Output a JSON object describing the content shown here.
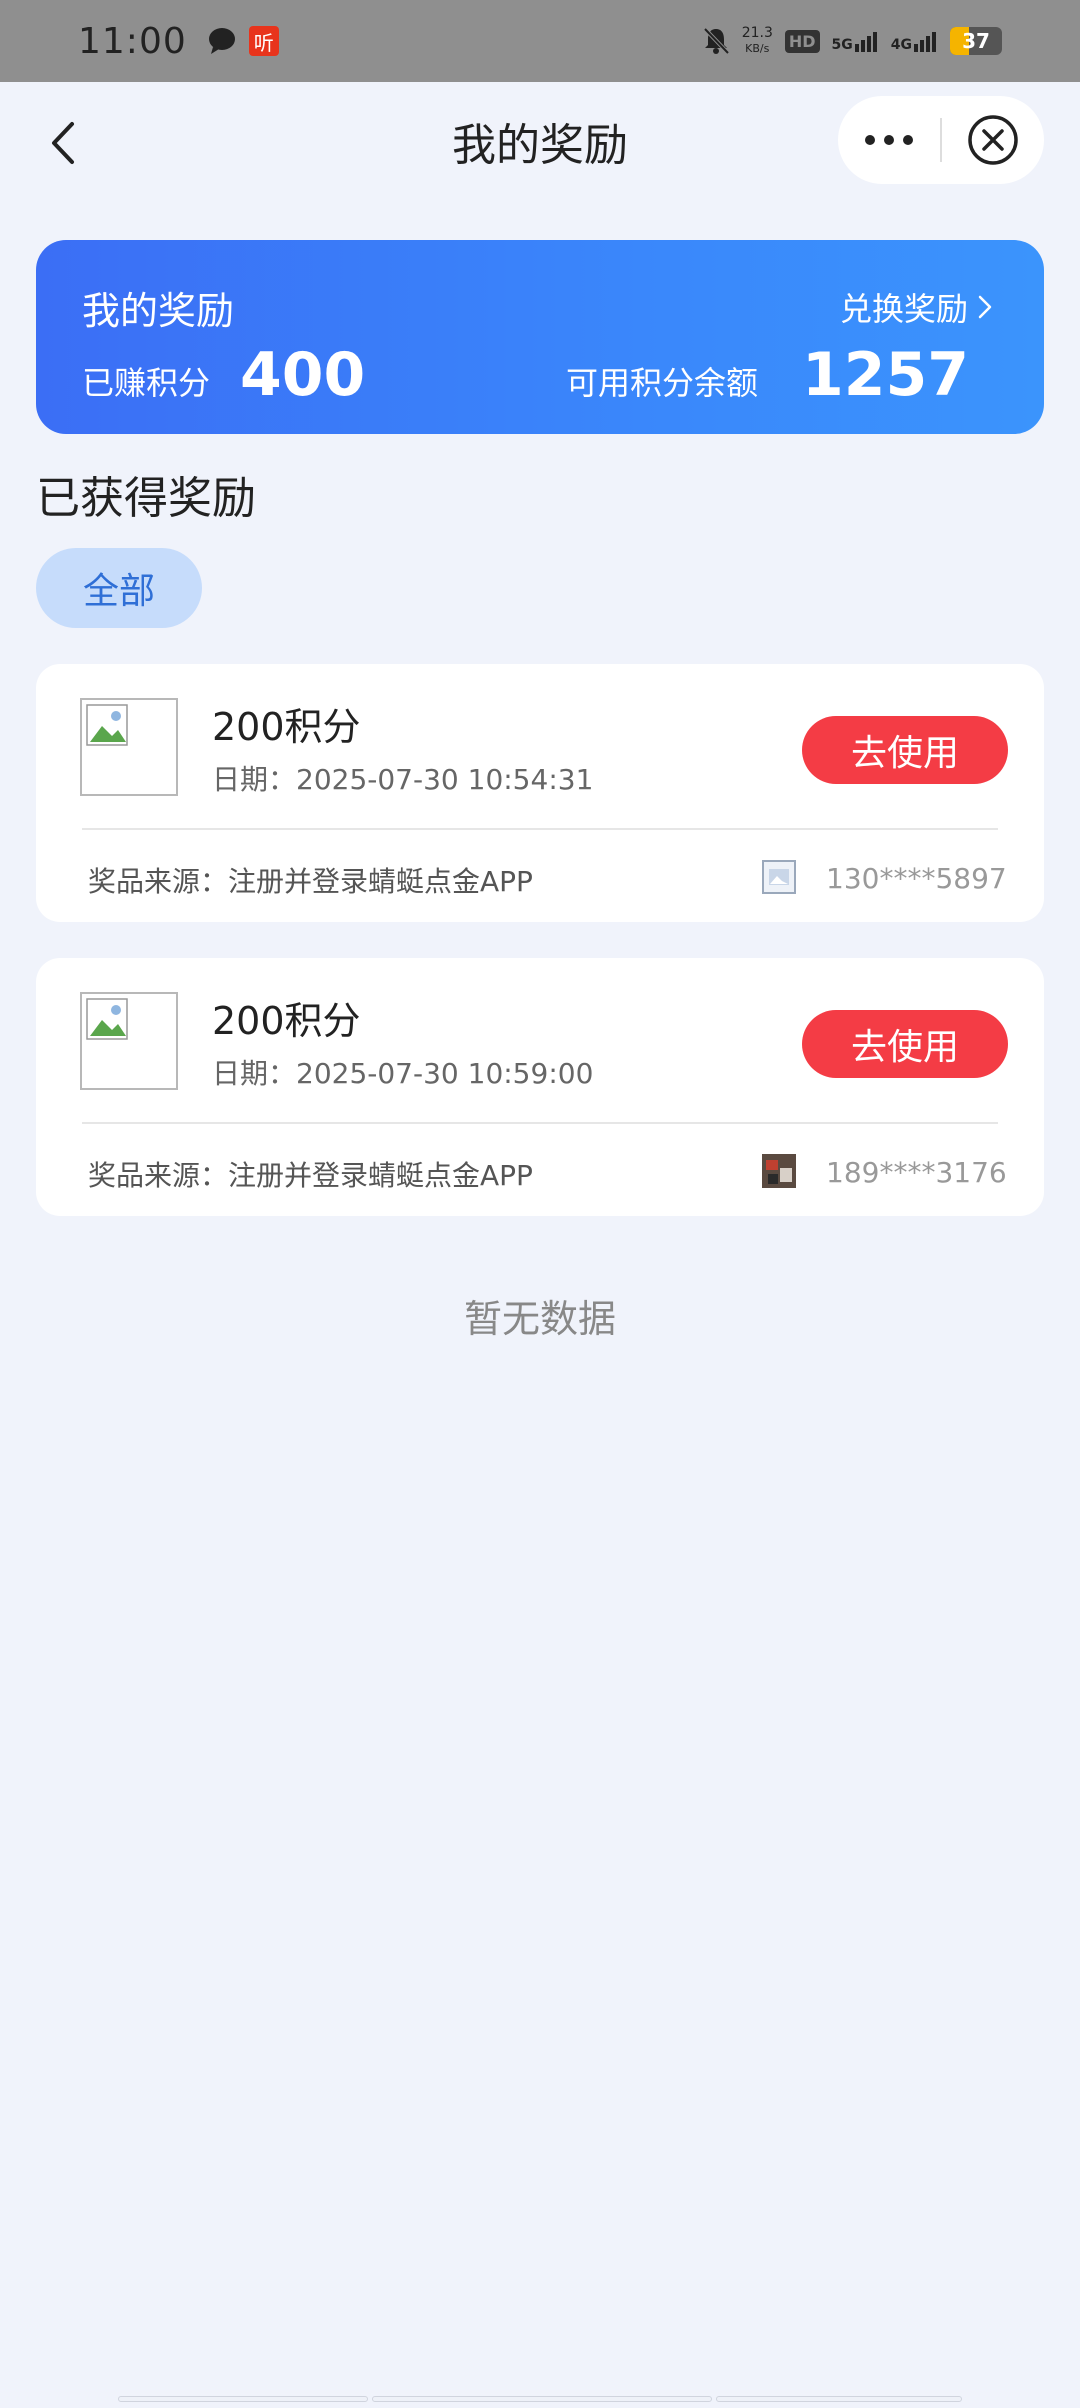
{
  "status_bar": {
    "time": "11:00",
    "ting_label": "听",
    "net_speed_value": "21.3",
    "net_speed_unit": "KB/s",
    "hd_label": "HD",
    "sim1_label": "5G",
    "sim2_label": "4G",
    "battery_level": "37",
    "battery_color": "#f5b400"
  },
  "header": {
    "title": "我的奖励"
  },
  "banner": {
    "title": "我的奖励",
    "exchange_link": "兑换奖励",
    "earned_label": "已赚积分",
    "earned_value": "400",
    "available_label": "可用积分余额",
    "available_value": "1257"
  },
  "section": {
    "title": "已获得奖励",
    "filter_all": "全部"
  },
  "rewards": [
    {
      "name": "200积分",
      "date": "日期：2025-07-30 10:54:31",
      "action": "去使用",
      "source": "奖品来源：注册并登录蜻蜓点金APP",
      "phone": "130****5897"
    },
    {
      "name": "200积分",
      "date": "日期：2025-07-30 10:59:00",
      "action": "去使用",
      "source": "奖品来源：注册并登录蜻蜓点金APP",
      "phone": "189****3176"
    }
  ],
  "empty_text": "暂无数据",
  "colors": {
    "accent_blue": "#3b6ef5",
    "use_button_red": "#f43c45",
    "pill_bg": "#c6dcfb",
    "page_bg": "#f0f3fb"
  }
}
